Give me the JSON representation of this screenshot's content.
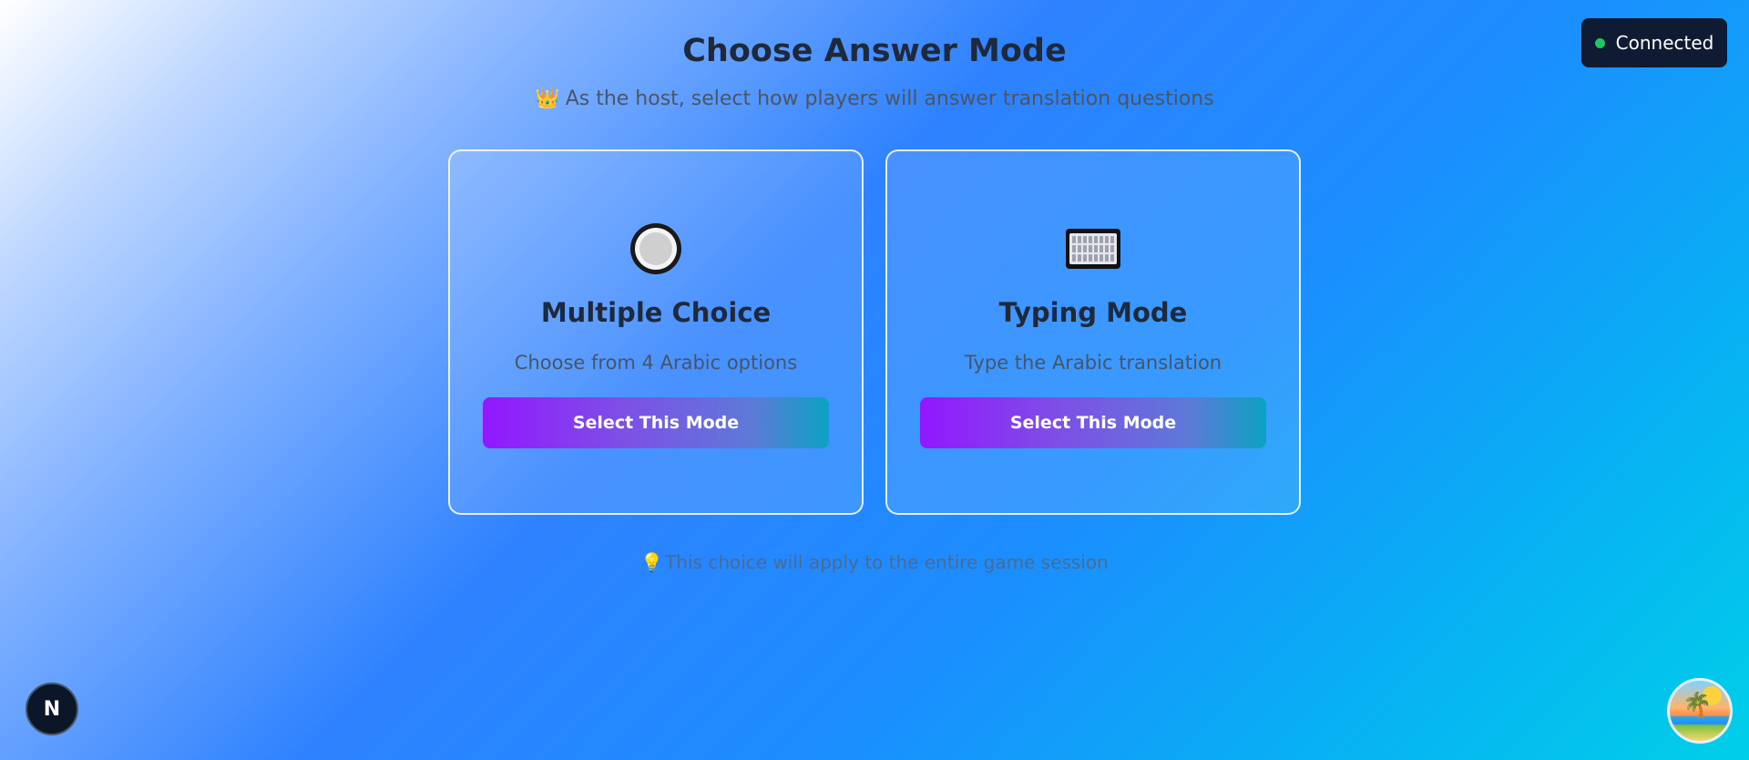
{
  "header": {
    "title": "Choose Answer Mode",
    "subtitle_emoji": "👑",
    "subtitle": "As the host, select how players will answer translation questions"
  },
  "status": {
    "label": "Connected",
    "color": "#22c55e"
  },
  "cards": [
    {
      "icon": "radio-button-icon",
      "title": "Multiple Choice",
      "description": "Choose from 4 Arabic options",
      "button_label": "Select This Mode"
    },
    {
      "icon": "keyboard-icon",
      "title": "Typing Mode",
      "description": "Type the Arabic translation",
      "button_label": "Select This Mode"
    }
  ],
  "footnote": {
    "emoji": "💡",
    "text": "This choice will apply to the entire game session"
  },
  "badges": {
    "left_letter": "N",
    "right_icon": "island-icon"
  },
  "colors": {
    "button_gradient_start": "#9217ff",
    "button_gradient_end": "#0aa3c2",
    "title": "#1e2a3b",
    "status_bg": "#0f1b33"
  }
}
